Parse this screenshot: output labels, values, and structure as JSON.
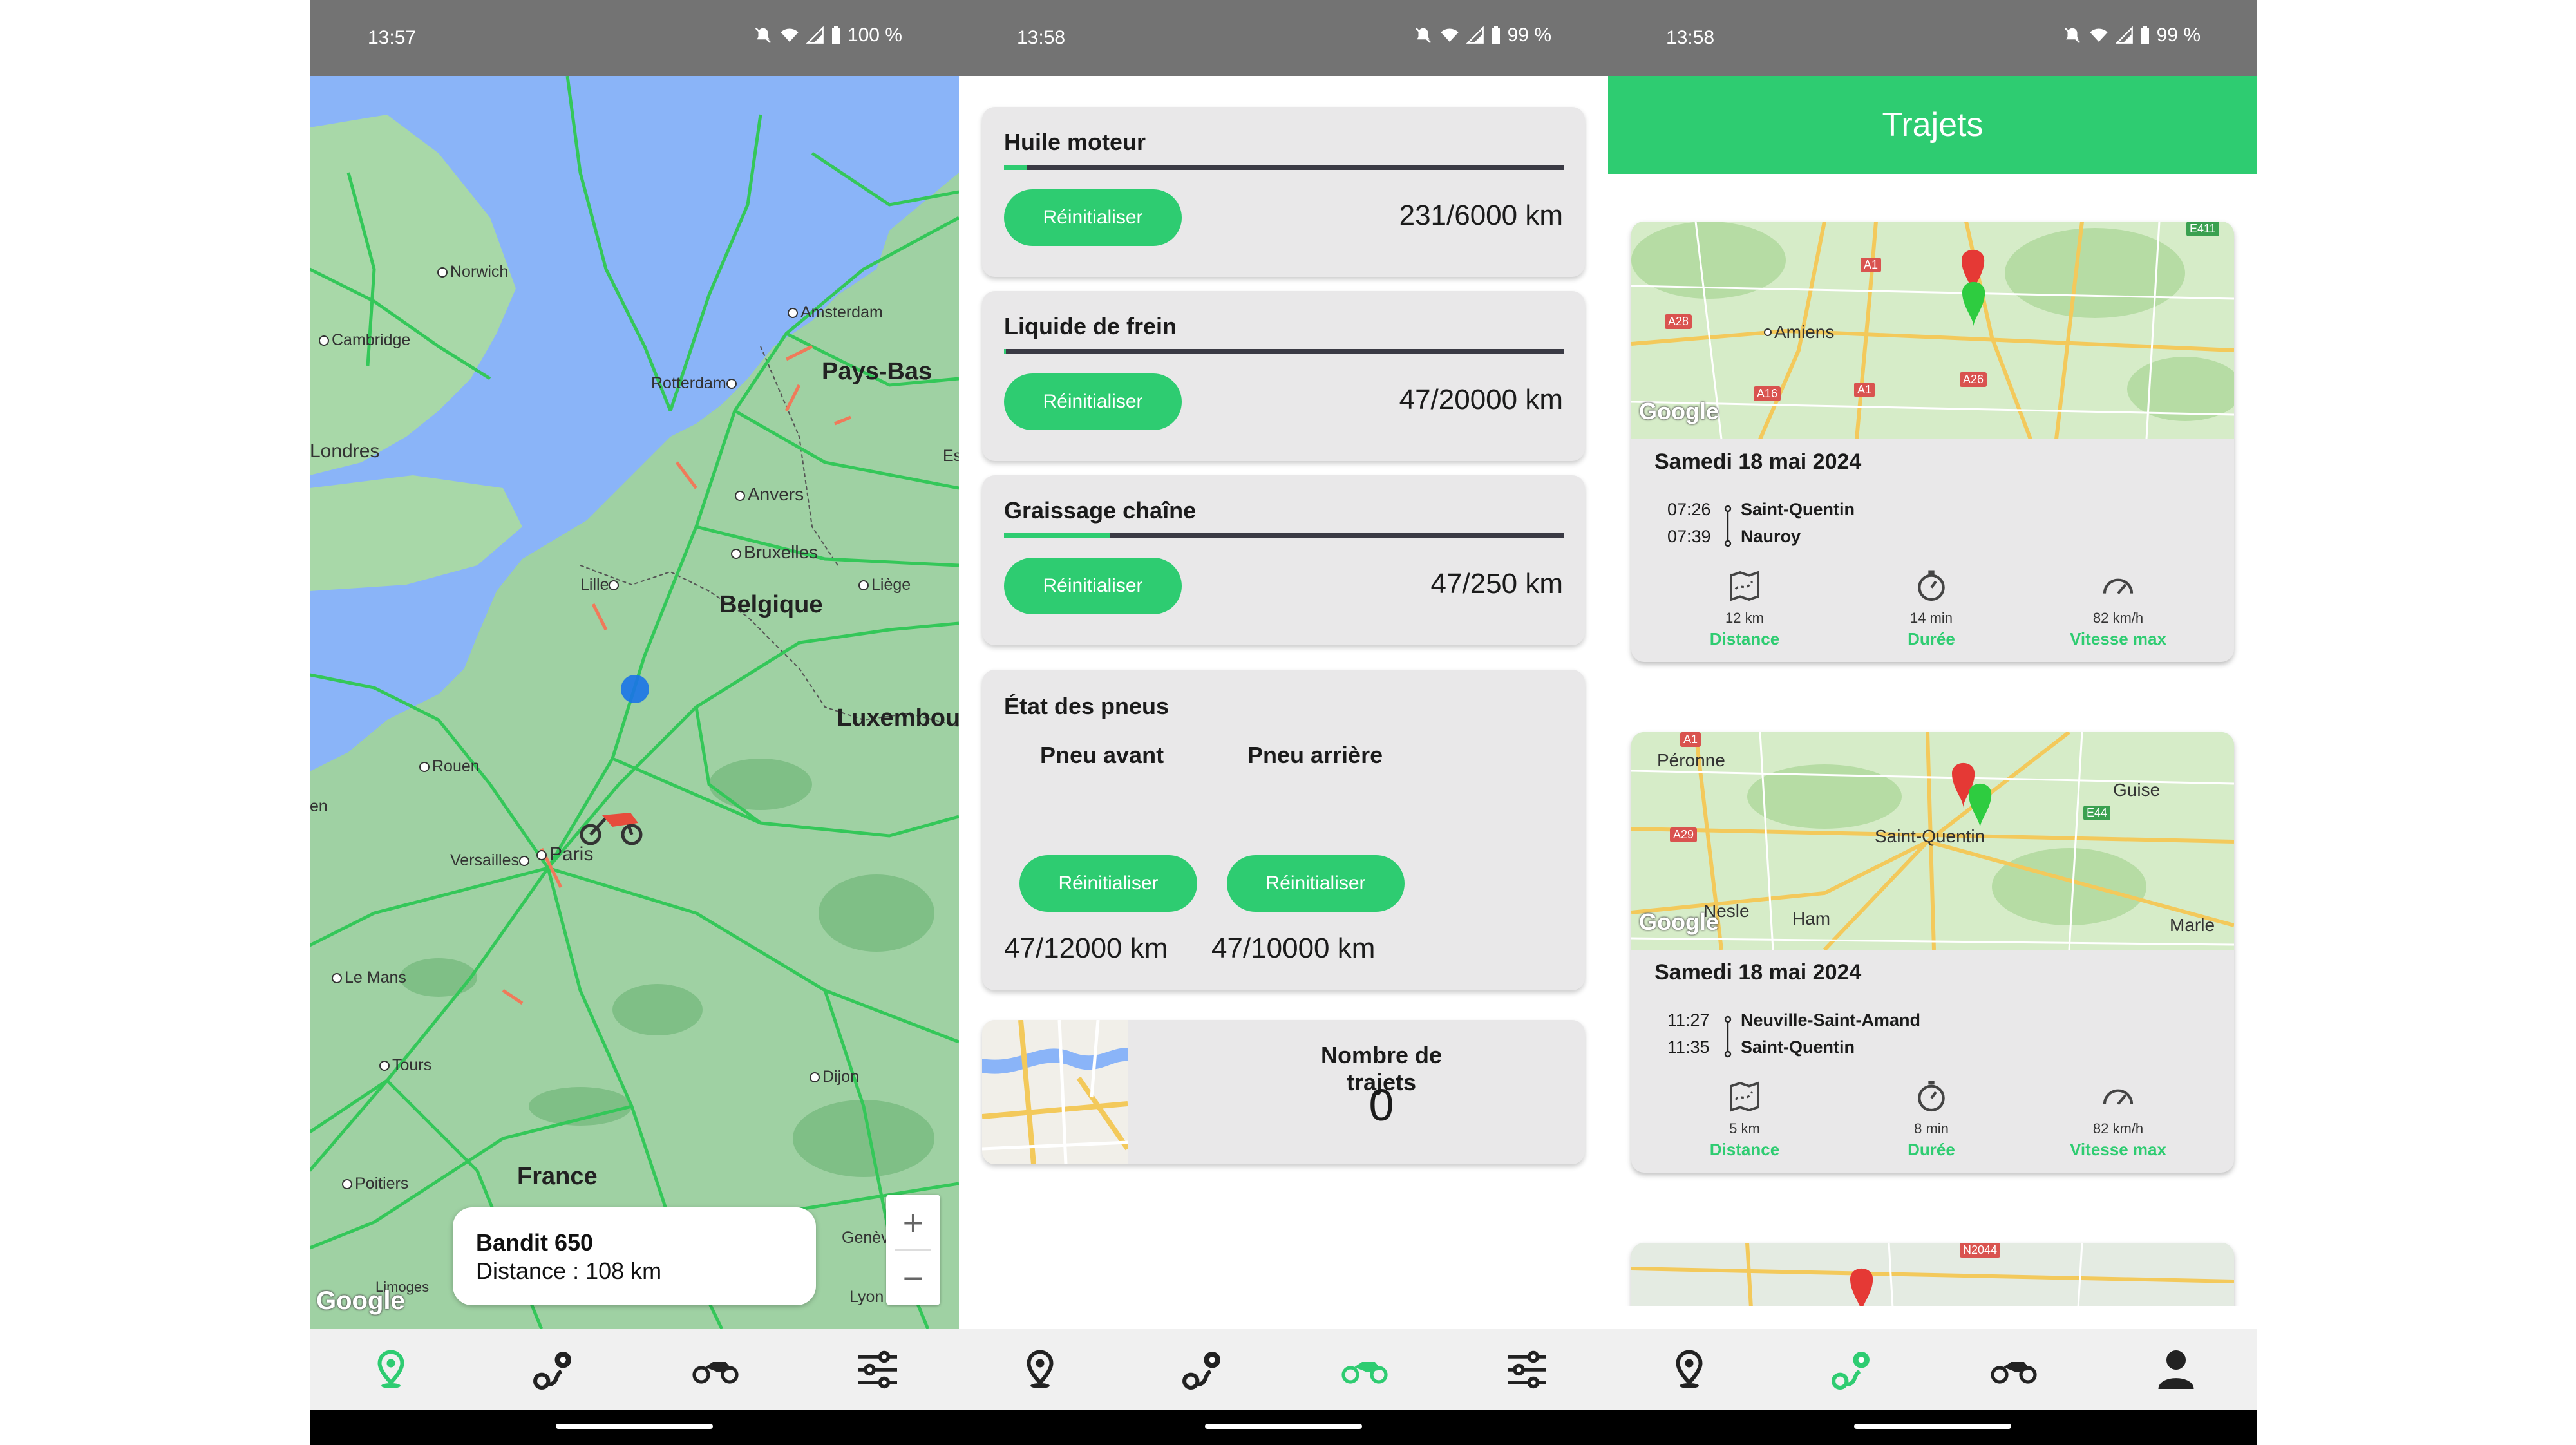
{
  "screens": [
    {
      "status": {
        "time": "13:57",
        "battery": "100 %"
      },
      "map": {
        "labels": {
          "norwich": "Norwich",
          "amsterdam": "Amsterdam",
          "cambridge": "Cambridge",
          "rotterdam": "Rotterdam",
          "paysbas": "Pays-Bas",
          "londres": "Londres",
          "anvers": "Anvers",
          "bruxelles": "Bruxelles",
          "lille": "Lille",
          "liege": "Liège",
          "belgique": "Belgique",
          "luxembourg": "Luxembou",
          "rouen": "Rouen",
          "versailles": "Versailles",
          "paris": "Paris",
          "lemans": "Le Mans",
          "tours": "Tours",
          "dijon": "Dijon",
          "poitiers": "Poitiers",
          "france": "France",
          "geneve": "Genève",
          "limoges": "Limoges",
          "lyon": "Lyon",
          "es": "Es",
          "en": "en"
        },
        "google": "Google",
        "zoom_in": "+",
        "zoom_out": "−"
      },
      "info_card": {
        "title": "Bandit 650",
        "distance": "Distance : 108 km"
      },
      "active_tab": 0
    },
    {
      "status": {
        "time": "13:58",
        "battery": "99 %"
      },
      "maintenance": [
        {
          "title": "Huile moteur",
          "button": "Réinitialiser",
          "value": "231/6000 km",
          "progress": 0.04
        },
        {
          "title": "Liquide de frein",
          "button": "Réinitialiser",
          "value": "47/20000 km",
          "progress": 0.002
        },
        {
          "title": "Graissage chaîne",
          "button": "Réinitialiser",
          "value": "47/250 km",
          "progress": 0.19
        }
      ],
      "tyres": {
        "title": "État des pneus",
        "front": {
          "label": "Pneu avant",
          "button": "Réinitialiser",
          "value": "47/12000 km"
        },
        "rear": {
          "label": "Pneu arrière",
          "button": "Réinitialiser",
          "value": "47/10000 km"
        }
      },
      "trip_count": {
        "label": "Nombre de trajets",
        "value": "0"
      },
      "active_tab": 2
    },
    {
      "status": {
        "time": "13:58",
        "battery": "99 %"
      },
      "header": "Trajets",
      "trips": [
        {
          "date": "Samedi 18 mai 2024",
          "start_time": "07:26",
          "start_place": "Saint-Quentin",
          "end_time": "07:39",
          "end_place": "Nauroy",
          "distance": "12 km",
          "duration": "14 min",
          "max_speed": "82 km/h",
          "map_labels": {
            "city1": "Amiens",
            "a1": "A1",
            "a28": "A28",
            "a16": "A16",
            "a1b": "A1",
            "a26": "A26",
            "e411": "E411"
          }
        },
        {
          "date": "Samedi 18 mai 2024",
          "start_time": "11:27",
          "start_place": "Neuville-Saint-Amand",
          "end_time": "11:35",
          "end_place": "Saint-Quentin",
          "distance": "5 km",
          "duration": "8 min",
          "max_speed": "82 km/h",
          "map_labels": {
            "city1": "Péronne",
            "city2": "Guise",
            "city3": "Saint-Quentin",
            "city4": "Nesle",
            "city5": "Ham",
            "city6": "Marle",
            "a1": "A1",
            "a29": "A29",
            "e44": "E44"
          }
        },
        {
          "map_labels": {
            "n2044": "N2044"
          }
        }
      ],
      "stat_labels": {
        "distance": "Distance",
        "duration": "Durée",
        "max_speed": "Vitesse max"
      },
      "google": "Google",
      "active_tab": 1
    }
  ],
  "colors": {
    "accent": "#2ecc71",
    "statusbar": "#737373",
    "card": "#e9e8e9",
    "progress_track": "#3a3a44"
  },
  "nav_icons": [
    "map-pin-icon",
    "route-icon",
    "motorcycle-icon",
    "settings-sliders-icon",
    "profile-icon"
  ]
}
